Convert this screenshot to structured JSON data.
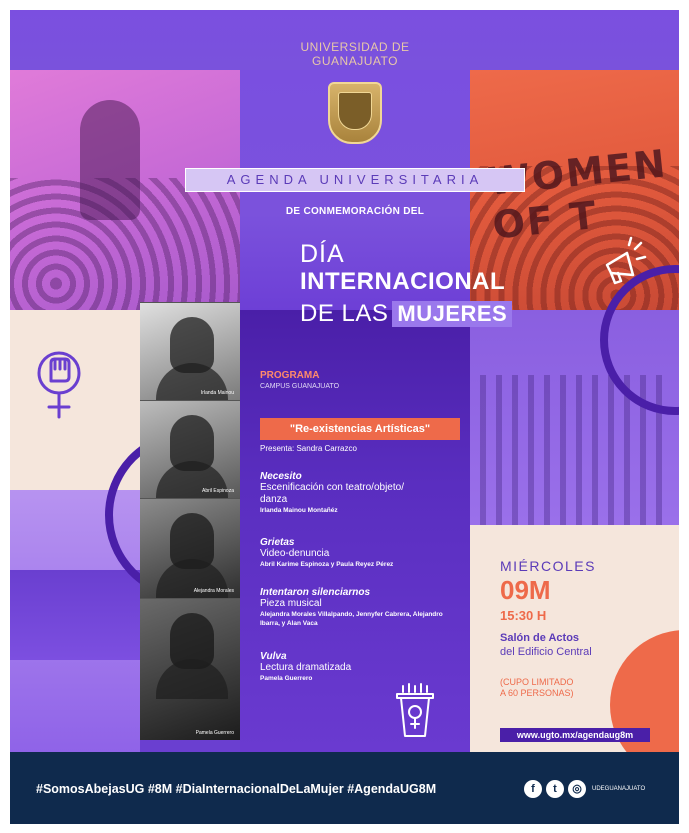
{
  "header": {
    "university_line1": "UNIVERSIDAD DE",
    "university_line2": "GUANAJUATO",
    "agenda": "AGENDA UNIVERSITARIA",
    "conmemoracion": "DE CONMEMORACIÓN DEL",
    "title_line1": "DÍA",
    "title_line2": "INTERNACIONAL",
    "title_line3a": "DE LAS",
    "title_line3b": "MUJERES",
    "banner_photo_text": "WOMEN OF T"
  },
  "program": {
    "label": "PROGRAMA",
    "campus": "CAMPUS GUANAJUATO",
    "event": "\"Re-existencias Artísticas\"",
    "presenta": "Presenta: Sandra Carrazco",
    "items": [
      {
        "title": "Necesito",
        "desc_line1": "Escenificación con teatro/objeto/",
        "desc_line2": "danza",
        "people": "Irlanda Mainou Montañéz"
      },
      {
        "title": "Grietas",
        "desc_line1": "Video-denuncia",
        "desc_line2": "",
        "people": "Abril Karime Espinoza y Paula Reyez Pérez"
      },
      {
        "title": "Intentaron silenciarnos",
        "desc_line1": "Pieza musical",
        "desc_line2": "",
        "people": "Alejandra Morales Villalpando, Jennyfer Cabrera, Alejandro Ibarra, y Alan Vaca"
      },
      {
        "title": "Vulva",
        "desc_line1": "Lectura dramatizada",
        "desc_line2": "",
        "people": "Pamela Guerrero"
      }
    ]
  },
  "photos": {
    "captions": [
      "Irlanda Mainou",
      "Abril Espinoza",
      "Alejandra Morales",
      "Pamela Guerrero"
    ]
  },
  "event_info": {
    "day": "MIÉRCOLES",
    "date_num": "09",
    "date_m": "M",
    "time": "15:30 H",
    "venue_line1": "Salón de Actos",
    "venue_line2": "del Edificio Central",
    "cupo_line1": "(CUPO LIMITADO",
    "cupo_line2": "A 60 PERSONAS)",
    "url": "www.ugto.mx/agendaug8m"
  },
  "footer": {
    "hashtags": "#SomosAbejasUG  #8M  #DiaInternacionalDeLaMujer  #AgendaUG8M",
    "social_icons": [
      "facebook-icon",
      "twitter-icon",
      "instagram-icon"
    ],
    "handle": "UDEGUANAJUATO"
  },
  "colors": {
    "purple": "#6a3fd0",
    "dark_purple": "#4a1fa8",
    "orange": "#ee6a4a",
    "pink": "#e07bd9",
    "cream": "#f5e6dc",
    "navy": "#0f2a4d"
  }
}
